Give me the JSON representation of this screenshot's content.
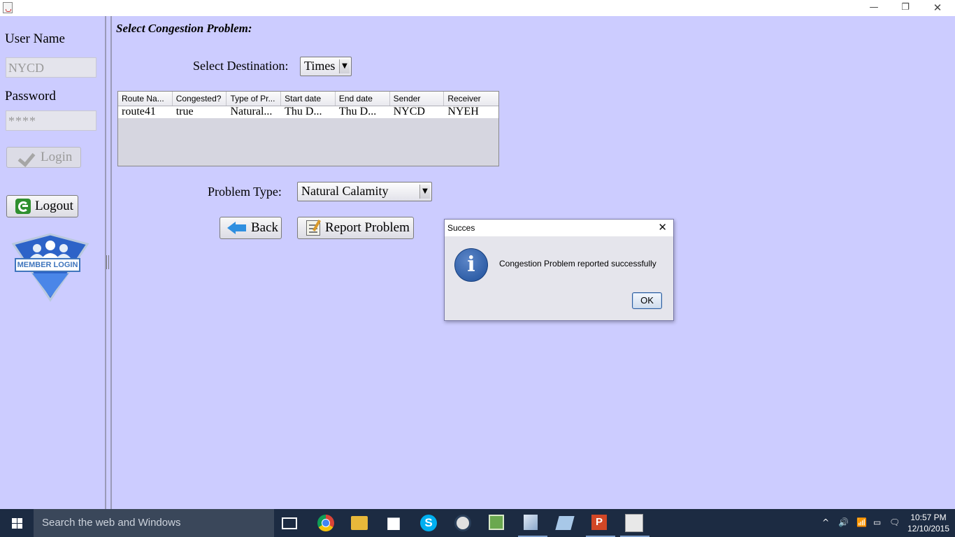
{
  "window": {
    "minimize_glyph": "—",
    "maximize_glyph": "❐",
    "close_glyph": "✕"
  },
  "login": {
    "user_label": "User Name",
    "user_value": "NYCD",
    "password_label": "Password",
    "password_value": "****",
    "login_label": "Login",
    "logout_label": "Logout",
    "member_login_text": "MEMBER LOGIN"
  },
  "main": {
    "heading": "Select Congestion Problem:",
    "destination_label": "Select Destination:",
    "destination_value": "Times",
    "problem_type_label": "Problem Type:",
    "problem_type_value": "Natural Calamity",
    "back_label": "Back",
    "report_label": "Report Problem",
    "table": {
      "columns": [
        "Route Na...",
        "Congested?",
        "Type of Pr...",
        "Start date",
        "End date",
        "Sender",
        "Receiver"
      ],
      "rows": [
        [
          "route41",
          "true",
          "Natural...",
          "Thu D...",
          "Thu D...",
          "NYCD",
          "NYEH"
        ]
      ]
    }
  },
  "dialog": {
    "title": "Succes",
    "message": "Congestion Problem reported successfully",
    "ok_label": "OK",
    "close_glyph": "✕",
    "info_glyph": "i"
  },
  "taskbar": {
    "search_placeholder": "Search the web and Windows",
    "skype_glyph": "S",
    "ppt_glyph": "P",
    "tray_up": "^",
    "tray_volume": "🔊",
    "tray_network": "📶",
    "tray_battery": "▭",
    "tray_message": "🗨",
    "time": "10:57 PM",
    "date": "12/10/2015"
  }
}
